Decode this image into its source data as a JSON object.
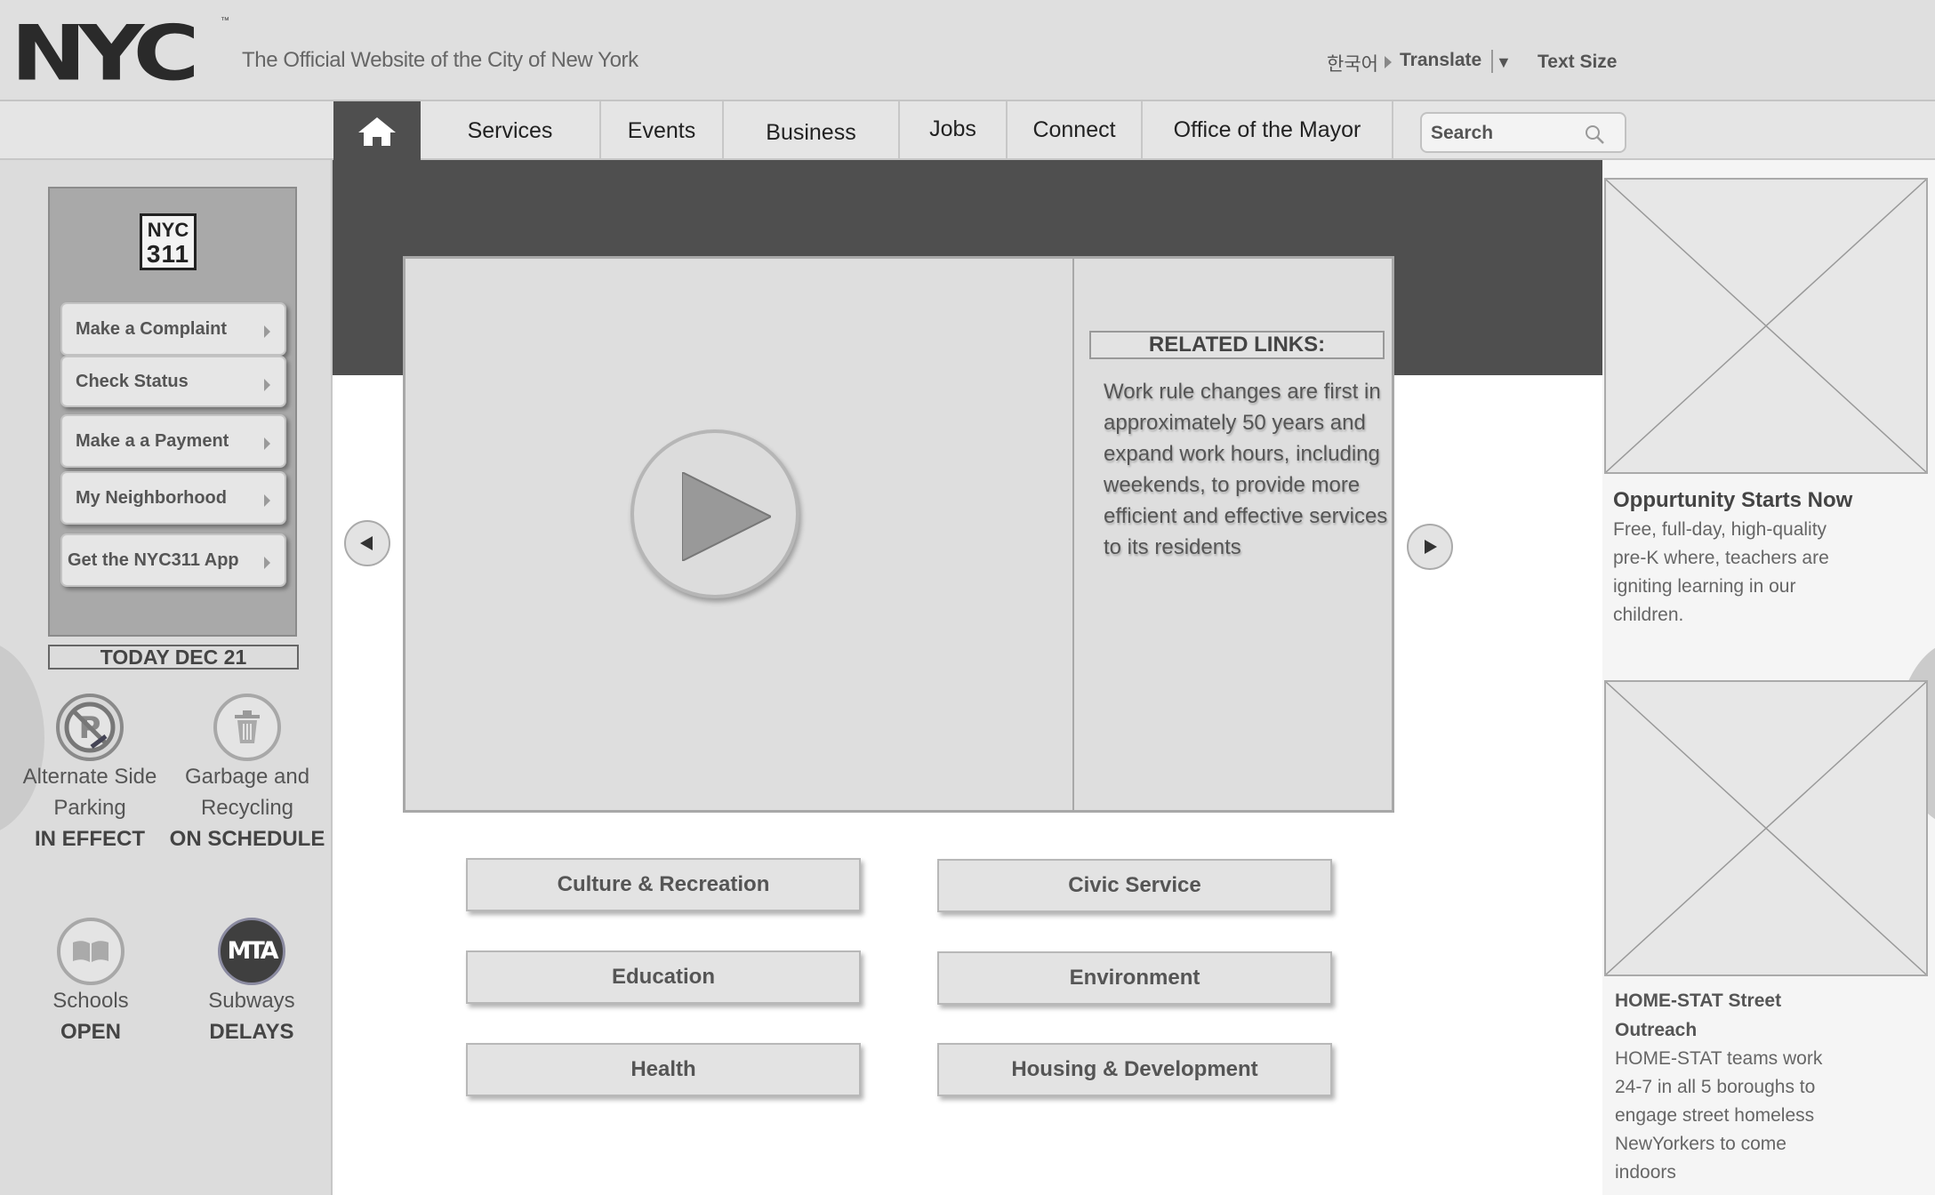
{
  "header": {
    "logo": "NYC",
    "trademark": "™",
    "tagline": "The Official Website of the City of New York",
    "language": "한국어",
    "translate": "Translate",
    "translate_arrow": "▼",
    "text_size": "Text Size"
  },
  "nav": {
    "items": [
      "Services",
      "Events",
      "Business",
      "Jobs",
      "Connect",
      "Office of the Mayor"
    ],
    "search_placeholder": "Search"
  },
  "nyc311": {
    "logo_line1": "NYC",
    "logo_line2": "311",
    "buttons": [
      "Make a Complaint",
      "Check Status",
      "Make a a Payment",
      "My Neighborhood",
      "Get the NYC311 App"
    ]
  },
  "today": "TODAY DEC 21",
  "statuses": [
    {
      "label_line1": "Alternate Side",
      "label_line2": "Parking",
      "value": "IN EFFECT",
      "icon": "no-parking-icon"
    },
    {
      "label_line1": "Garbage and",
      "label_line2": "Recycling",
      "value": "ON SCHEDULE",
      "icon": "trash-can-icon"
    },
    {
      "label_line1": "Schools",
      "label_line2": "",
      "value": "OPEN",
      "icon": "book-icon"
    },
    {
      "label_line1": "Subways",
      "label_line2": "",
      "value": "DELAYS",
      "icon": "mta-icon",
      "icon_text": "MTA"
    }
  ],
  "hero": {
    "related_title": "RELATED LINKS:",
    "related_text": "Work rule changes are first in approximately 50 years and expand work hours, including weekends, to provide more efficient and effective services to its residents"
  },
  "categories": [
    "Culture & Recreation",
    "Civic Service",
    "Education",
    "Environment",
    "Health",
    "Housing & Development"
  ],
  "cards": [
    {
      "title": "Oppurtunity Starts Now",
      "lines": [
        "Free, full-day, high-quality",
        "pre-K where,  teachers are",
        "igniting learning in our",
        "children."
      ]
    },
    {
      "title_lines": [
        "HOME-STAT Street",
        "Outreach"
      ],
      "lines": [
        "HOME-STAT teams work",
        "24-7 in all 5 boroughs to",
        "engage street homeless",
        "NewYorkers to come",
        "indoors"
      ]
    }
  ],
  "colors": {
    "dark_band": "#4f4f4f",
    "page_bg": "#dedede"
  }
}
